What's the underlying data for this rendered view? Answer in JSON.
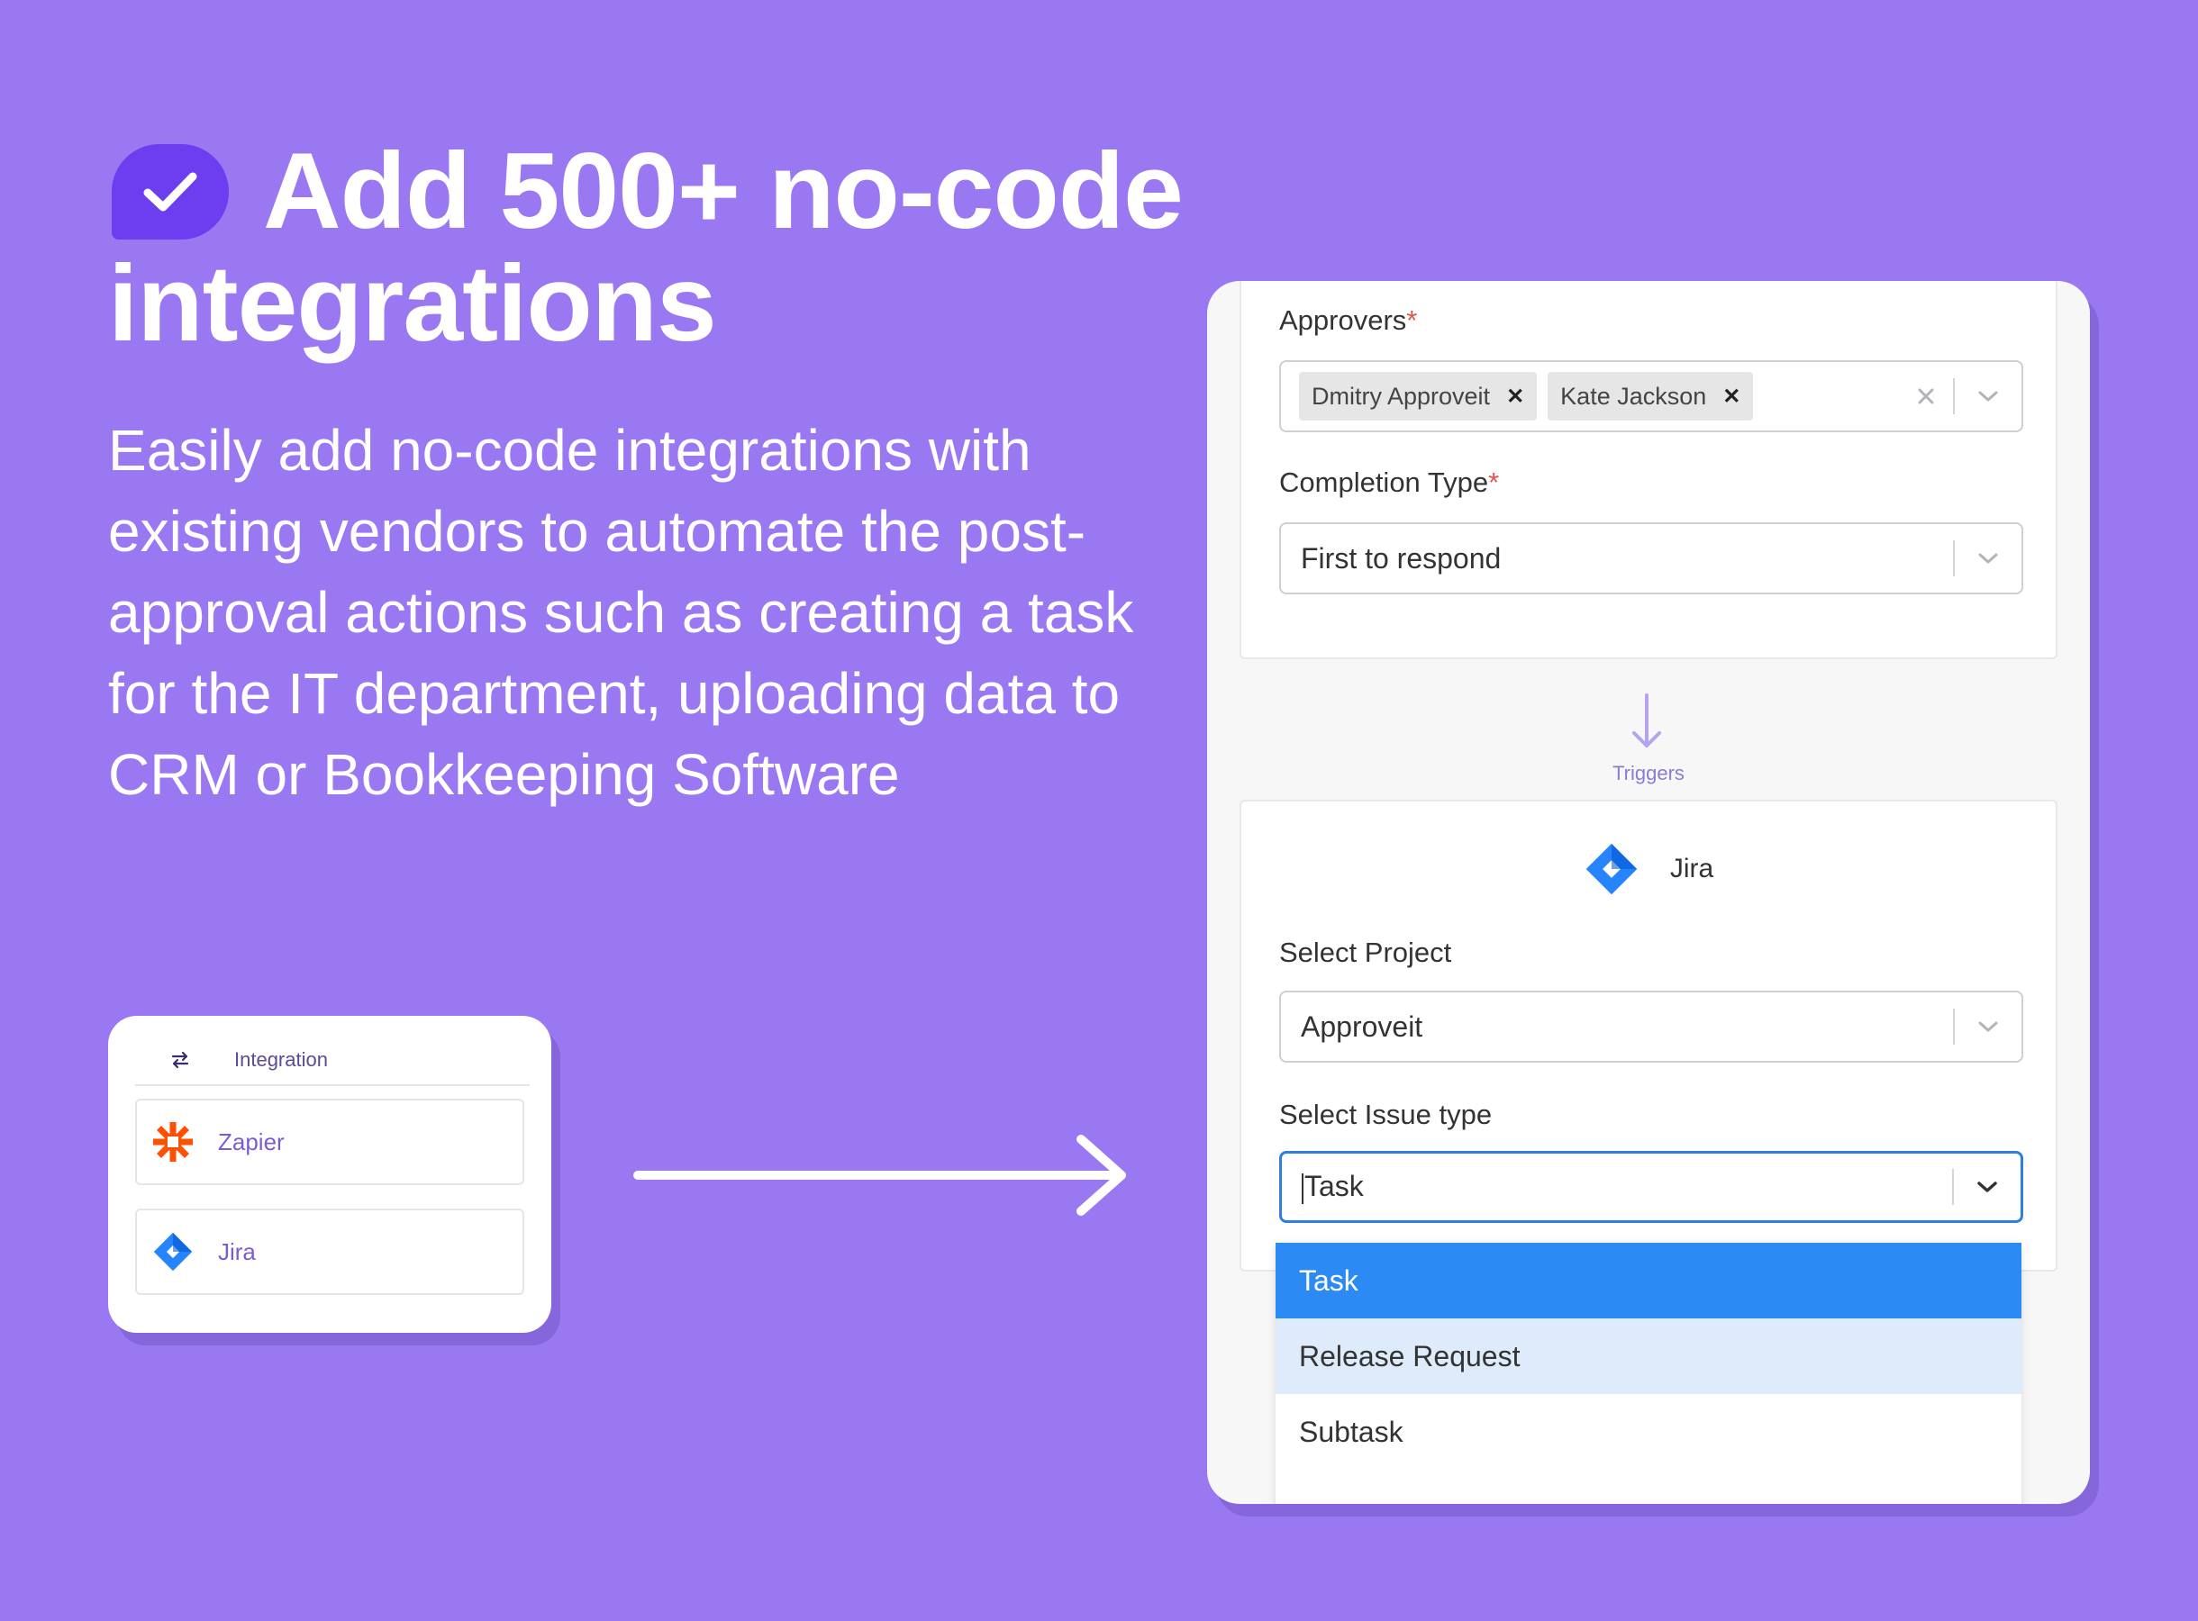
{
  "hero": {
    "title_line1": "Add 500+ no-code",
    "title_line2": "integrations",
    "description": "Easily add no-code integrations with existing vendors to automate the post-approval actions such as creating a task for the IT department, uploading data to CRM or Bookkeeping Software"
  },
  "integration_card": {
    "header_label": "Integration",
    "items": [
      {
        "name": "Zapier",
        "icon": "zapier-icon"
      },
      {
        "name": "Jira",
        "icon": "jira-icon"
      }
    ]
  },
  "form": {
    "approvers": {
      "label": "Approvers",
      "required_mark": "*",
      "tags": [
        "Dmitry Approveit",
        "Kate Jackson"
      ]
    },
    "completion_type": {
      "label": "Completion Type",
      "required_mark": "*",
      "value": "First to respond"
    },
    "trigger_label": "Triggers",
    "jira": {
      "title": "Jira",
      "project": {
        "label": "Select Project",
        "value": "Approveit"
      },
      "issue_type": {
        "label": "Select Issue type",
        "value": "Task"
      },
      "options": [
        "Task",
        "Release Request",
        "Subtask"
      ]
    }
  },
  "colors": {
    "background": "#9a78f2",
    "badge": "#6c3ef0",
    "selected_option": "#2c8af5",
    "hover_option": "#deebfb",
    "focus_border": "#2f7fde",
    "jira_blue": "#2684ff",
    "zapier_orange": "#ff4f00"
  }
}
